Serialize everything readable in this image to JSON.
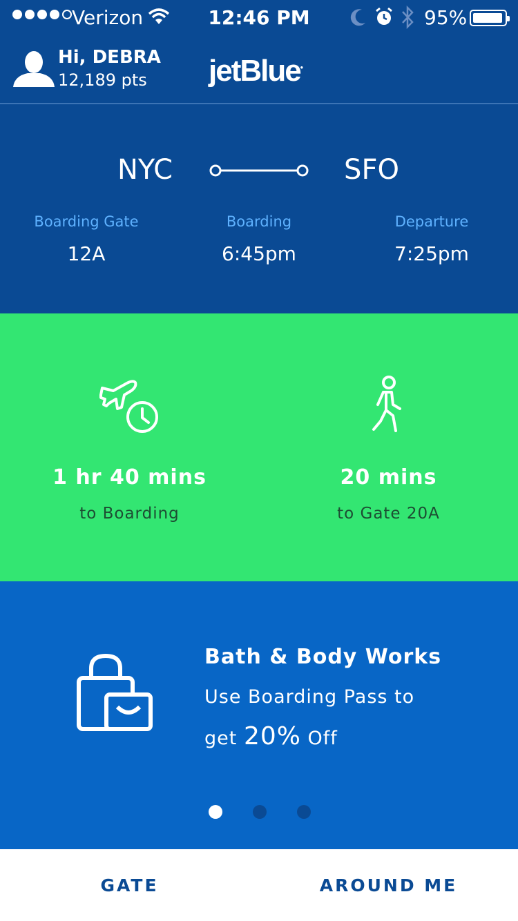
{
  "status_bar": {
    "carrier": "Verizon",
    "time": "12:46 PM",
    "battery": "95%",
    "signal_bars": 4,
    "icons": [
      "signal-icon",
      "wifi-icon",
      "moon-icon",
      "alarm-icon",
      "bluetooth-icon",
      "battery-icon"
    ]
  },
  "header": {
    "greeting": "Hi, DEBRA",
    "points": "12,189 pts",
    "logo": "jetBlue"
  },
  "flight": {
    "origin": "NYC",
    "destination": "SFO",
    "gate_label": "Boarding Gate",
    "gate_value": "12A",
    "boarding_label": "Boarding",
    "boarding_value": "6:45pm",
    "departure_label": "Departure",
    "departure_value": "7:25pm"
  },
  "timing": {
    "boarding_time": "1 hr 40 mins",
    "boarding_caption": "to Boarding",
    "walk_time": "20 mins",
    "walk_caption": "to Gate 20A"
  },
  "promo": {
    "title": "Bath & Body Works",
    "line1": "Use Boarding Pass to",
    "line2_prefix": "get",
    "line2_pct": "20%",
    "line2_suffix": "Off",
    "page_count": 3,
    "active_page": 1
  },
  "tabs": {
    "gate": "GATE",
    "around_me": "AROUND ME"
  },
  "colors": {
    "navy": "#0a4a94",
    "green": "#33e672",
    "promo_blue": "#0866c6",
    "label_blue": "#5fb2ff"
  }
}
